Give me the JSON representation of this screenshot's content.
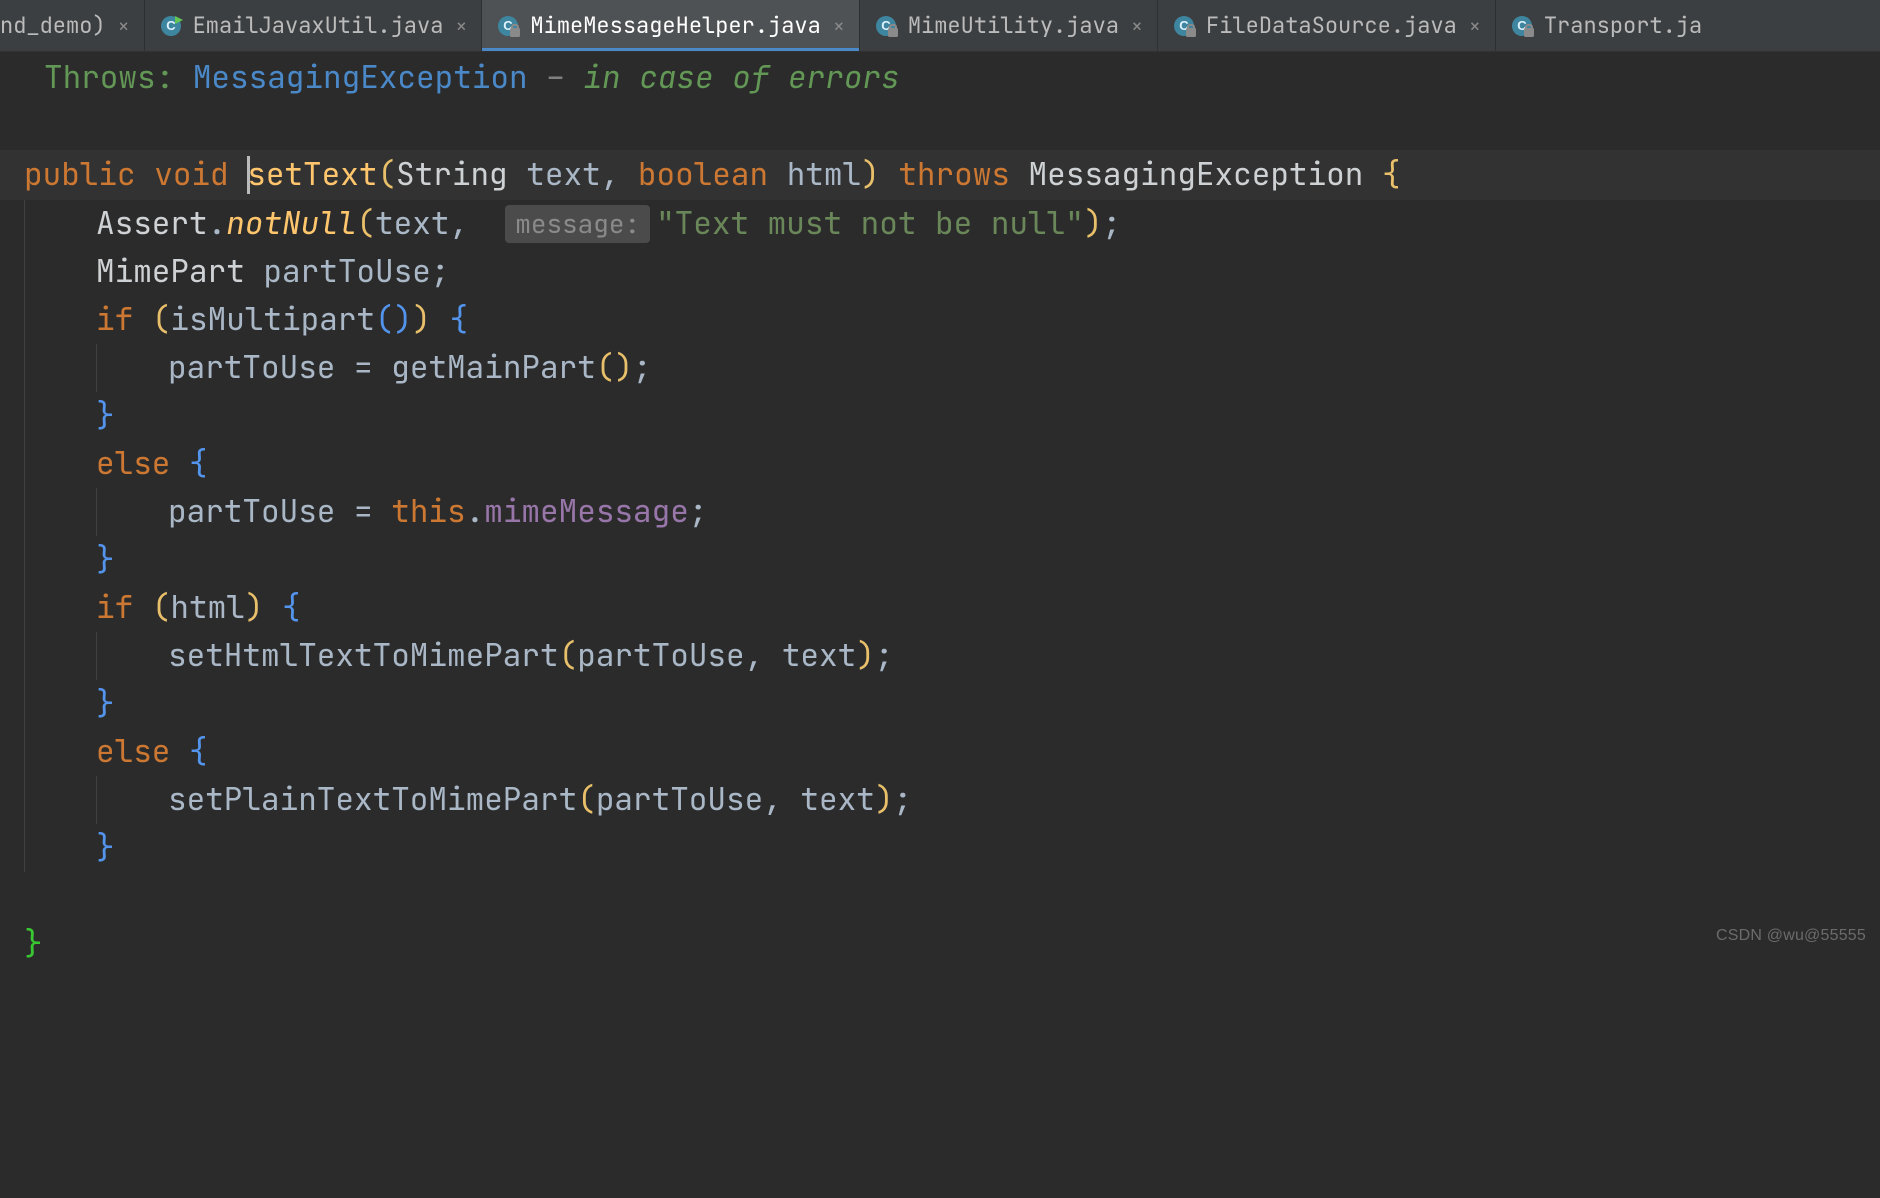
{
  "tabs": {
    "trunc_left": "nd_demo)",
    "items": [
      {
        "label": "EmailJavaxUtil.java",
        "icon": "class-run-icon",
        "locked": false,
        "active": false
      },
      {
        "label": "MimeMessageHelper.java",
        "icon": "class-icon",
        "locked": true,
        "active": true
      },
      {
        "label": "MimeUtility.java",
        "icon": "class-icon",
        "locked": true,
        "active": false
      },
      {
        "label": "FileDataSource.java",
        "icon": "class-icon",
        "locked": true,
        "active": false
      }
    ],
    "trunc_right": "Transport.ja"
  },
  "javadoc": {
    "throws_label": "Throws:",
    "exception": "MessagingException",
    "dash": " – ",
    "desc": "in case of errors"
  },
  "sig": {
    "public": "public",
    "void": "void",
    "name": "setText",
    "p1_type": "String",
    "p1_name": "text",
    "p2_type": "boolean",
    "p2_name": "html",
    "throws": "throws",
    "exc": "MessagingException"
  },
  "body": {
    "assert_cls": "Assert",
    "assert_m": "notNull",
    "assert_arg": "text",
    "hint_label": "message:",
    "assert_str": "\"Text must not be null\"",
    "decl_type": "MimePart",
    "decl_name": "partToUse",
    "if": "if",
    "else": "else",
    "isMultipart": "isMultipart",
    "getMainPart": "getMainPart",
    "this": "this",
    "mimeMessage": "mimeMessage",
    "html_var": "html",
    "setHtml": "setHtmlTextToMimePart",
    "setPlain": "setPlainTextToMimePart",
    "partToUse": "partToUse",
    "text_var": "text"
  },
  "watermark": "CSDN @wu@55555"
}
